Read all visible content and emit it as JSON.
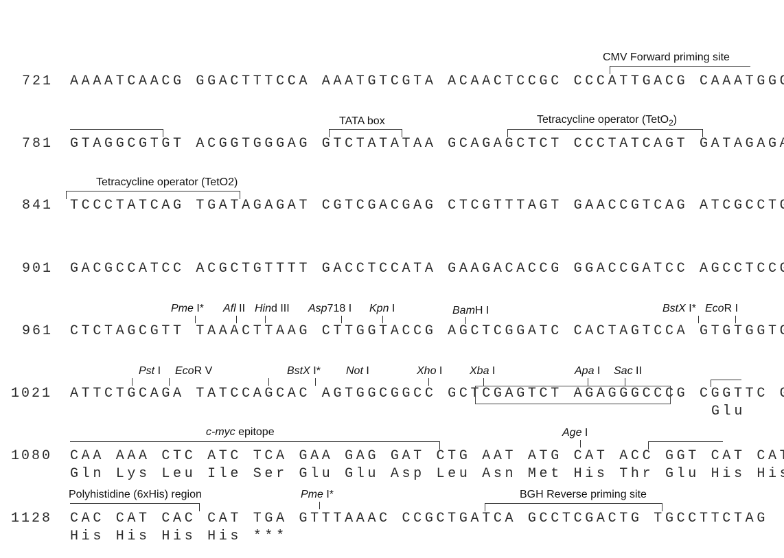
{
  "rows": [
    {
      "num": "721",
      "seq": "AAAATCAACG GGACTTTCCA AAATGTCGTA ACAACTCCGC CCCATTGACG CAAATGGGCG"
    },
    {
      "num": "781",
      "seq": "GTAGGCGTGT ACGGTGGGAG GTCTATATAA GCAGAGCTCT CCCTATCAGT GATAGAGATC"
    },
    {
      "num": "841",
      "seq": "TCCCTATCAG TGATAGAGAT CGTCGACGAG CTCGTTTAGT GAACCGTCAG ATCGCCTGGA"
    },
    {
      "num": "901",
      "seq": "GACGCCATCC ACGCTGTTTT GACCTCCATA GAAGACACCG GGACCGATCC AGCCTCCGGA"
    },
    {
      "num": "961",
      "seq": "CTCTAGCGTT TAAACTTAAG CTTGGTACCG AGCTCGGATC CACTAGTCCA GTGTGGTGGA"
    },
    {
      "num": "1021",
      "seq": "ATTCTGCAGA TATCCAGCAC AGTGGCGGCC GCTCGAGTCT AGAGGGCCCG CGGTTC GAA",
      "aa": "Glu"
    },
    {
      "num": "1080",
      "seq": "CAA AAA CTC ATC TCA GAA GAG GAT CTG AAT ATG CAT ACC GGT CAT CAT",
      "aa": "Gln Lys Leu Ile Ser Glu Glu Asp Leu Asn Met His Thr Glu His His"
    },
    {
      "num": "1128",
      "seq": "CAC CAT CAC CAT TGA GTTTAAAC CCGCTGATCA GCCTCGACTG TGCCTTCTAG",
      "aa": "His His His His ***"
    }
  ],
  "features": {
    "cmv_forward": "CMV Forward priming site",
    "tata_box": "TATA box",
    "teto2_a_prefix": "Tetracycline operator (TetO",
    "teto2_a_sub": "2",
    "teto2_a_suffix": ")",
    "teto2_b": "Tetracycline operator (TetO2)",
    "cmyc_italic": "c-myc",
    "cmyc_rest": " epitope",
    "polyhis": "Polyhistidine (6xHis) region",
    "bgh_reverse": "BGH Reverse priming site"
  },
  "sites": {
    "pme1": {
      "it": "Pme",
      "rn": " I*"
    },
    "afl2": {
      "it": "Afl",
      "rn": " II"
    },
    "hind3": {
      "it": "Hin",
      "rn": "d III"
    },
    "asp718": {
      "it": "Asp",
      "rn": "718 I"
    },
    "kpn1": {
      "it": "Kpn",
      "rn": " I"
    },
    "bamh1": {
      "it": "Bam",
      "rn": "H I"
    },
    "bstx1a": {
      "it": "BstX",
      "rn": " I*"
    },
    "ecor1": {
      "it": "Eco",
      "rn": "R I"
    },
    "pst1": {
      "it": "Pst",
      "rn": " I"
    },
    "ecorv": {
      "it": "Eco",
      "rn": "R V"
    },
    "bstx1b": {
      "it": "BstX",
      "rn": " I*"
    },
    "not1": {
      "it": "Not",
      "rn": " I"
    },
    "xho1": {
      "it": "Xho",
      "rn": " I"
    },
    "xba1": {
      "it": "Xba",
      "rn": " I"
    },
    "apa1": {
      "it": "Apa",
      "rn": " I"
    },
    "sac2": {
      "it": "Sac",
      "rn": " II"
    },
    "age1": {
      "it": "Age",
      "rn": " I"
    },
    "pme1b": {
      "it": "Pme",
      "rn": " I*"
    }
  }
}
